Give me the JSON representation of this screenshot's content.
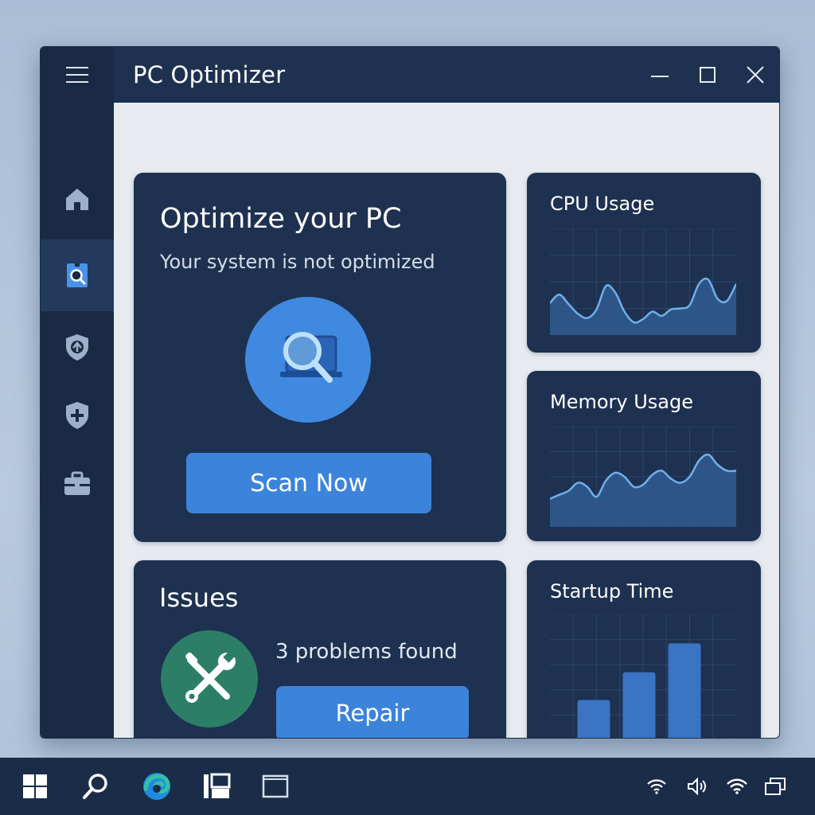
{
  "window": {
    "title": "PC Optimizer",
    "controls": [
      "minimize-icon",
      "maximize-icon",
      "close-icon"
    ]
  },
  "sidebar": {
    "items": [
      {
        "name": "home",
        "icon": "home-icon",
        "active": false
      },
      {
        "name": "scan",
        "icon": "scan-icon",
        "active": true
      },
      {
        "name": "update",
        "icon": "shield-arrow-icon",
        "active": false
      },
      {
        "name": "protection",
        "icon": "shield-plus-icon",
        "active": false
      },
      {
        "name": "toolbox",
        "icon": "briefcase-icon",
        "active": false
      }
    ]
  },
  "optimize": {
    "title": "Optimize your PC",
    "subtitle": "Your system is not optimized",
    "icon": "magnifier-laptop-icon",
    "button_label": "Scan Now"
  },
  "issues": {
    "title": "Issues",
    "icon": "tools-icon",
    "status": "3 problems found",
    "button_label": "Repair"
  },
  "cpu": {
    "title": "CPU Usage"
  },
  "memory": {
    "title": "Memory Usage"
  },
  "startup": {
    "title": "Startup Time"
  },
  "taskbar": {
    "left": [
      "windows-start-icon",
      "search-icon",
      "edge-browser-icon",
      "task-view-icon",
      "window-icon"
    ],
    "tray": [
      "wifi-icon",
      "volume-icon",
      "wifi-icon",
      "notification-icon"
    ]
  },
  "colors": {
    "window_bg": "#e7ebf0",
    "card_bg": "#1e3150",
    "accent": "#3c84db",
    "chart_fill": "#2f5a8e",
    "chart_line": "#6fb0ec",
    "issues_circle": "#2c7f66"
  },
  "chart_data": [
    {
      "type": "area",
      "title": "CPU Usage",
      "x": [
        0,
        1,
        2,
        3,
        4,
        5,
        6,
        7,
        8,
        9,
        10,
        11,
        12,
        13,
        14,
        15,
        16,
        17,
        18,
        19,
        20
      ],
      "values": [
        30,
        38,
        29,
        20,
        16,
        24,
        46,
        40,
        22,
        12,
        15,
        22,
        18,
        24,
        25,
        28,
        48,
        52,
        34,
        32,
        48
      ],
      "ylim": [
        0,
        100
      ],
      "grid": true
    },
    {
      "type": "area",
      "title": "Memory Usage",
      "x": [
        0,
        1,
        2,
        3,
        4,
        5,
        6,
        7,
        8,
        9,
        10,
        11,
        12,
        13,
        14,
        15,
        16,
        17,
        18,
        19,
        20
      ],
      "values": [
        28,
        32,
        36,
        44,
        40,
        30,
        46,
        54,
        50,
        40,
        42,
        52,
        56,
        48,
        44,
        50,
        66,
        72,
        62,
        56,
        56
      ],
      "ylim": [
        0,
        100
      ],
      "grid": true
    },
    {
      "type": "bar",
      "title": "Startup Time",
      "categories": [
        "1",
        "2",
        "3"
      ],
      "values": [
        32,
        54,
        77
      ],
      "ylim": [
        0,
        100
      ],
      "grid": true
    }
  ]
}
